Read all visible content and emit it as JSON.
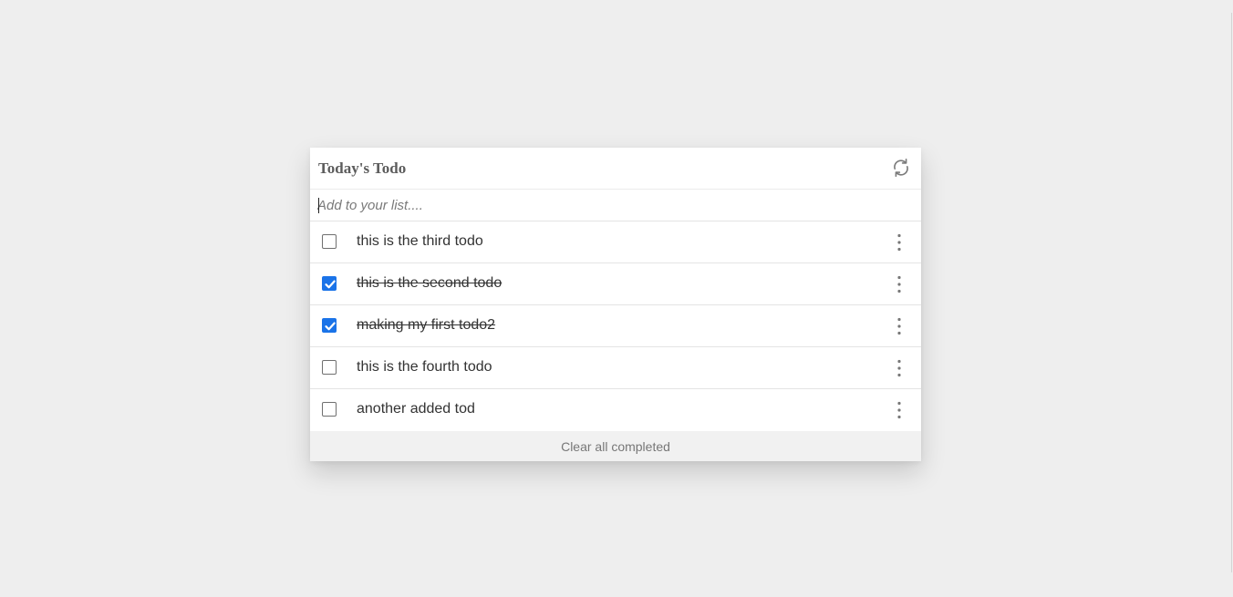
{
  "header": {
    "title": "Today's Todo",
    "refresh_icon": "refresh-icon"
  },
  "add_input": {
    "placeholder": "Add to your list....",
    "value": ""
  },
  "todos": [
    {
      "text": "this is the third todo",
      "completed": false
    },
    {
      "text": "this is the second todo",
      "completed": true
    },
    {
      "text": "making my first todo2",
      "completed": true
    },
    {
      "text": "this is the fourth todo",
      "completed": false
    },
    {
      "text": "another added tod",
      "completed": false
    }
  ],
  "footer": {
    "clear_label": "Clear all completed"
  },
  "colors": {
    "page_bg": "#eeeeee",
    "card_bg": "#ffffff",
    "accent_checkbox": "#1a73e8",
    "title_text": "#5c5c5c",
    "footer_bg": "#f1f1f1"
  },
  "icons": {
    "row_menu": "more-vertical-icon",
    "checkmark": "checkmark-icon"
  }
}
